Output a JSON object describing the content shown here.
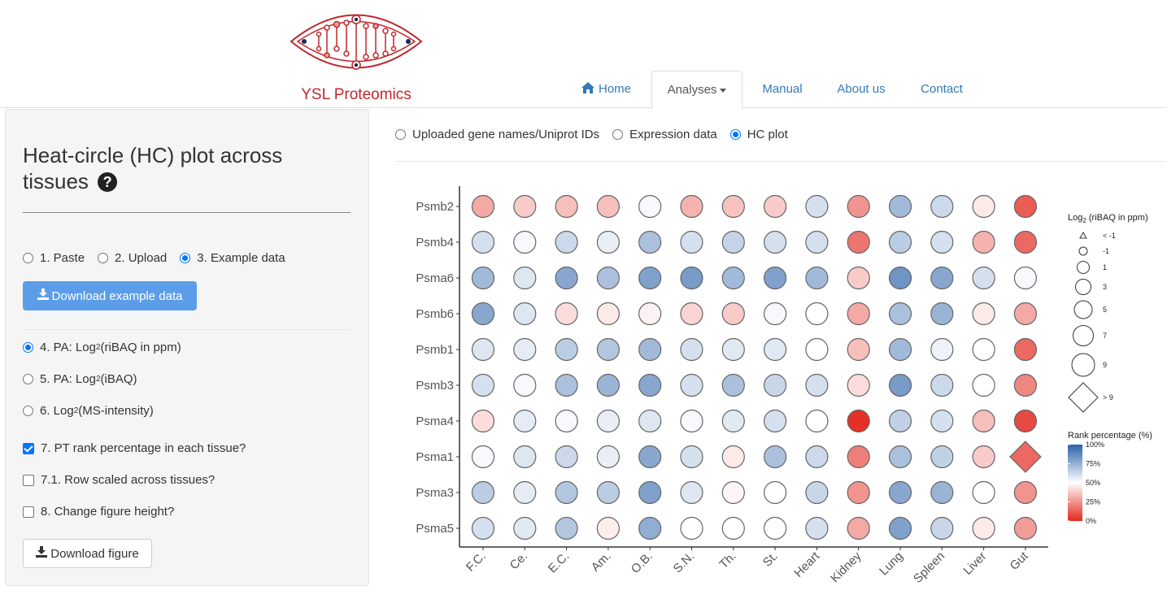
{
  "brand": {
    "name": "YSL Proteomics"
  },
  "nav": {
    "home": "Home",
    "analyses": "Analyses",
    "manual": "Manual",
    "about": "About us",
    "contact": "Contact"
  },
  "sidebar": {
    "title": "Heat-circle (HC) plot across tissues",
    "help_glyph": "?",
    "input_options": [
      "1. Paste",
      "2. Upload",
      "3. Example data"
    ],
    "input_selected": "3. Example data",
    "download_example": "Download example data",
    "pa1_prefix": "4. PA: Log",
    "pa1_sub": "2",
    "pa1_suffix": "(riBAQ in ppm)",
    "pa2_prefix": "5. PA: Log",
    "pa2_sub": "2",
    "pa2_suffix": "(iBAQ)",
    "pa3_prefix": "6. Log",
    "pa3_sub": "2",
    "pa3_suffix": "(MS-intensity)",
    "pa_selected": 4,
    "check7": {
      "label": "7. PT rank percentage in each tissue?",
      "checked": true
    },
    "check71": {
      "label": "7.1. Row scaled across tissues?",
      "checked": false
    },
    "check8": {
      "label": "8. Change figure height?",
      "checked": false
    },
    "download_figure": "Download figure"
  },
  "mode": {
    "options": [
      "Uploaded gene names/Uniprot IDs",
      "Expression data",
      "HC plot"
    ],
    "selected": "HC plot"
  },
  "chart_data": {
    "type": "heat-circle",
    "rows": [
      "Psmb2",
      "Psmb4",
      "Psma6",
      "Psmb6",
      "Psmb1",
      "Psmb3",
      "Psma4",
      "Psma1",
      "Psma3",
      "Psma5"
    ],
    "columns": [
      "F.C.",
      "Ce.",
      "E.C.",
      "Am.",
      "O.B.",
      "S.N.",
      "Th.",
      "St.",
      "Heart",
      "Kidney",
      "Lung",
      "Spleen",
      "Liver",
      "Gut"
    ],
    "rank_percentage": [
      [
        30,
        38,
        35,
        35,
        52,
        32,
        36,
        38,
        60,
        25,
        72,
        62,
        45,
        12
      ],
      [
        60,
        52,
        62,
        55,
        70,
        60,
        64,
        60,
        60,
        18,
        66,
        60,
        32,
        15
      ],
      [
        72,
        58,
        78,
        70,
        80,
        82,
        72,
        80,
        72,
        38,
        84,
        78,
        60,
        52
      ],
      [
        78,
        58,
        42,
        45,
        47,
        40,
        38,
        52,
        50,
        30,
        70,
        74,
        45,
        30
      ],
      [
        58,
        56,
        66,
        68,
        72,
        60,
        57,
        57,
        50,
        35,
        72,
        54,
        50,
        15
      ],
      [
        60,
        52,
        70,
        74,
        78,
        60,
        70,
        63,
        60,
        42,
        82,
        62,
        50,
        22
      ],
      [
        42,
        56,
        52,
        55,
        58,
        52,
        57,
        60,
        50,
        2,
        65,
        60,
        35,
        8
      ],
      [
        52,
        58,
        62,
        55,
        78,
        60,
        45,
        70,
        62,
        20,
        70,
        65,
        38,
        15
      ],
      [
        66,
        56,
        68,
        66,
        80,
        58,
        48,
        50,
        63,
        25,
        78,
        74,
        50,
        25
      ],
      [
        60,
        57,
        68,
        46,
        76,
        50,
        50,
        50,
        60,
        30,
        80,
        63,
        45,
        27
      ]
    ],
    "size_legend_title_prefix": "Log",
    "size_legend_title_sub": "2",
    "size_legend_title_suffix": " (riBAQ in ppm)",
    "size_legend": [
      "< -1",
      "-1",
      "1",
      "3",
      "5",
      "7",
      "9",
      "> 9"
    ],
    "color_legend_title": "Rank percentage (%)",
    "color_legend": [
      "100%",
      "75%",
      "50%",
      "25%",
      "0%"
    ],
    "colors": {
      "high": "#2c62a8",
      "mid": "#ffffff",
      "low": "#e3281e"
    }
  }
}
